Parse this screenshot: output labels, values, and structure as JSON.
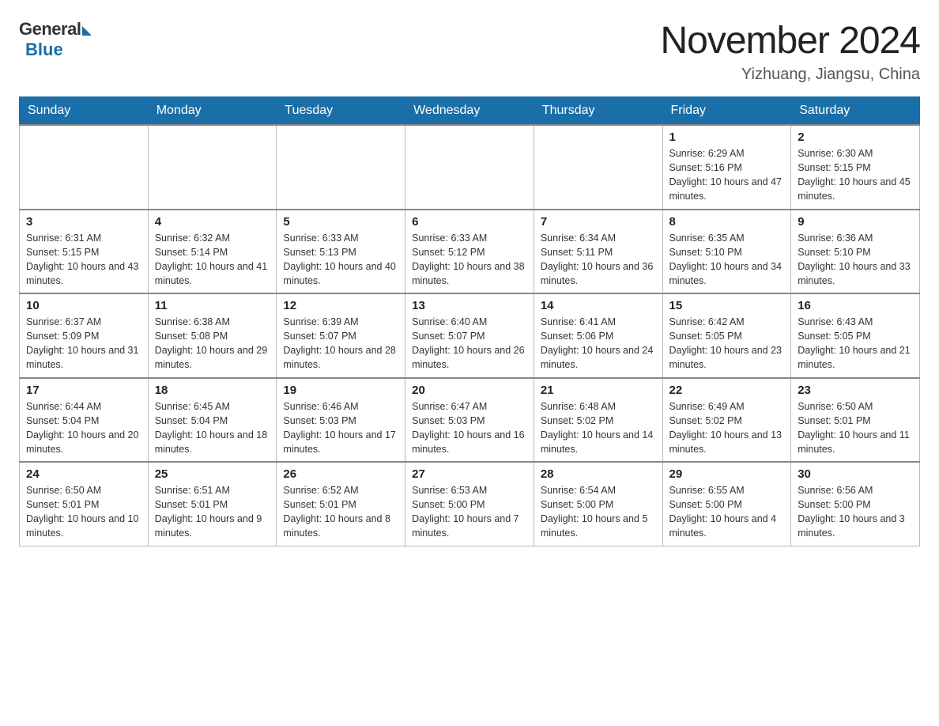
{
  "header": {
    "logo_general": "General",
    "logo_blue": "Blue",
    "month_title": "November 2024",
    "location": "Yizhuang, Jiangsu, China"
  },
  "weekdays": [
    "Sunday",
    "Monday",
    "Tuesday",
    "Wednesday",
    "Thursday",
    "Friday",
    "Saturday"
  ],
  "weeks": [
    [
      {
        "day": "",
        "info": ""
      },
      {
        "day": "",
        "info": ""
      },
      {
        "day": "",
        "info": ""
      },
      {
        "day": "",
        "info": ""
      },
      {
        "day": "",
        "info": ""
      },
      {
        "day": "1",
        "info": "Sunrise: 6:29 AM\nSunset: 5:16 PM\nDaylight: 10 hours and 47 minutes."
      },
      {
        "day": "2",
        "info": "Sunrise: 6:30 AM\nSunset: 5:15 PM\nDaylight: 10 hours and 45 minutes."
      }
    ],
    [
      {
        "day": "3",
        "info": "Sunrise: 6:31 AM\nSunset: 5:15 PM\nDaylight: 10 hours and 43 minutes."
      },
      {
        "day": "4",
        "info": "Sunrise: 6:32 AM\nSunset: 5:14 PM\nDaylight: 10 hours and 41 minutes."
      },
      {
        "day": "5",
        "info": "Sunrise: 6:33 AM\nSunset: 5:13 PM\nDaylight: 10 hours and 40 minutes."
      },
      {
        "day": "6",
        "info": "Sunrise: 6:33 AM\nSunset: 5:12 PM\nDaylight: 10 hours and 38 minutes."
      },
      {
        "day": "7",
        "info": "Sunrise: 6:34 AM\nSunset: 5:11 PM\nDaylight: 10 hours and 36 minutes."
      },
      {
        "day": "8",
        "info": "Sunrise: 6:35 AM\nSunset: 5:10 PM\nDaylight: 10 hours and 34 minutes."
      },
      {
        "day": "9",
        "info": "Sunrise: 6:36 AM\nSunset: 5:10 PM\nDaylight: 10 hours and 33 minutes."
      }
    ],
    [
      {
        "day": "10",
        "info": "Sunrise: 6:37 AM\nSunset: 5:09 PM\nDaylight: 10 hours and 31 minutes."
      },
      {
        "day": "11",
        "info": "Sunrise: 6:38 AM\nSunset: 5:08 PM\nDaylight: 10 hours and 29 minutes."
      },
      {
        "day": "12",
        "info": "Sunrise: 6:39 AM\nSunset: 5:07 PM\nDaylight: 10 hours and 28 minutes."
      },
      {
        "day": "13",
        "info": "Sunrise: 6:40 AM\nSunset: 5:07 PM\nDaylight: 10 hours and 26 minutes."
      },
      {
        "day": "14",
        "info": "Sunrise: 6:41 AM\nSunset: 5:06 PM\nDaylight: 10 hours and 24 minutes."
      },
      {
        "day": "15",
        "info": "Sunrise: 6:42 AM\nSunset: 5:05 PM\nDaylight: 10 hours and 23 minutes."
      },
      {
        "day": "16",
        "info": "Sunrise: 6:43 AM\nSunset: 5:05 PM\nDaylight: 10 hours and 21 minutes."
      }
    ],
    [
      {
        "day": "17",
        "info": "Sunrise: 6:44 AM\nSunset: 5:04 PM\nDaylight: 10 hours and 20 minutes."
      },
      {
        "day": "18",
        "info": "Sunrise: 6:45 AM\nSunset: 5:04 PM\nDaylight: 10 hours and 18 minutes."
      },
      {
        "day": "19",
        "info": "Sunrise: 6:46 AM\nSunset: 5:03 PM\nDaylight: 10 hours and 17 minutes."
      },
      {
        "day": "20",
        "info": "Sunrise: 6:47 AM\nSunset: 5:03 PM\nDaylight: 10 hours and 16 minutes."
      },
      {
        "day": "21",
        "info": "Sunrise: 6:48 AM\nSunset: 5:02 PM\nDaylight: 10 hours and 14 minutes."
      },
      {
        "day": "22",
        "info": "Sunrise: 6:49 AM\nSunset: 5:02 PM\nDaylight: 10 hours and 13 minutes."
      },
      {
        "day": "23",
        "info": "Sunrise: 6:50 AM\nSunset: 5:01 PM\nDaylight: 10 hours and 11 minutes."
      }
    ],
    [
      {
        "day": "24",
        "info": "Sunrise: 6:50 AM\nSunset: 5:01 PM\nDaylight: 10 hours and 10 minutes."
      },
      {
        "day": "25",
        "info": "Sunrise: 6:51 AM\nSunset: 5:01 PM\nDaylight: 10 hours and 9 minutes."
      },
      {
        "day": "26",
        "info": "Sunrise: 6:52 AM\nSunset: 5:01 PM\nDaylight: 10 hours and 8 minutes."
      },
      {
        "day": "27",
        "info": "Sunrise: 6:53 AM\nSunset: 5:00 PM\nDaylight: 10 hours and 7 minutes."
      },
      {
        "day": "28",
        "info": "Sunrise: 6:54 AM\nSunset: 5:00 PM\nDaylight: 10 hours and 5 minutes."
      },
      {
        "day": "29",
        "info": "Sunrise: 6:55 AM\nSunset: 5:00 PM\nDaylight: 10 hours and 4 minutes."
      },
      {
        "day": "30",
        "info": "Sunrise: 6:56 AM\nSunset: 5:00 PM\nDaylight: 10 hours and 3 minutes."
      }
    ]
  ]
}
